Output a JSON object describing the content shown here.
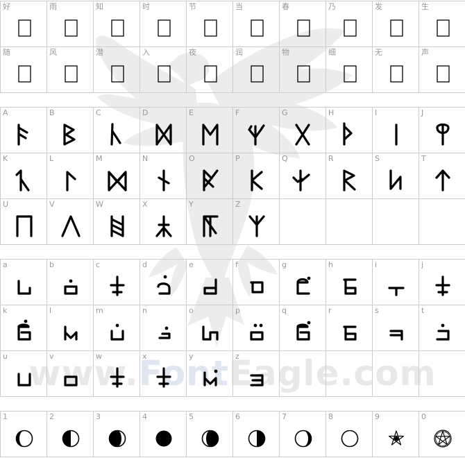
{
  "watermark": {
    "brand_prefix": "www.",
    "brand_font": "Font",
    "brand_eagle": "Eagle",
    "brand_suffix": ".com"
  },
  "sections": {
    "cjk": {
      "cells": [
        {
          "label": "好",
          "glyph": "tofu"
        },
        {
          "label": "雨",
          "glyph": "tofu"
        },
        {
          "label": "知",
          "glyph": "tofu"
        },
        {
          "label": "时",
          "glyph": "tofu"
        },
        {
          "label": "节",
          "glyph": "tofu"
        },
        {
          "label": "当",
          "glyph": "tofu"
        },
        {
          "label": "春",
          "glyph": "tofu"
        },
        {
          "label": "乃",
          "glyph": "tofu"
        },
        {
          "label": "发",
          "glyph": "tofu"
        },
        {
          "label": "生",
          "glyph": "tofu"
        },
        {
          "label": "随",
          "glyph": "tofu"
        },
        {
          "label": "风",
          "glyph": "tofu"
        },
        {
          "label": "潜",
          "glyph": "tofu"
        },
        {
          "label": "入",
          "glyph": "tofu"
        },
        {
          "label": "夜",
          "glyph": "tofu"
        },
        {
          "label": "润",
          "glyph": "tofu"
        },
        {
          "label": "物",
          "glyph": "tofu"
        },
        {
          "label": "细",
          "glyph": "tofu"
        },
        {
          "label": "无",
          "glyph": "tofu"
        },
        {
          "label": "声",
          "glyph": "tofu"
        }
      ]
    },
    "uppercase": {
      "cells": [
        {
          "label": "A",
          "glyph": "rune-f"
        },
        {
          "label": "B",
          "glyph": "rune-b"
        },
        {
          "label": "C",
          "glyph": "rune-c"
        },
        {
          "label": "D",
          "glyph": "rune-d"
        },
        {
          "label": "E",
          "glyph": "rune-e"
        },
        {
          "label": "F",
          "glyph": "rune-fw"
        },
        {
          "label": "G",
          "glyph": "rune-g"
        },
        {
          "label": "H",
          "glyph": "rune-h"
        },
        {
          "label": "I",
          "glyph": "rune-i"
        },
        {
          "label": "J",
          "glyph": "rune-j"
        },
        {
          "label": "K",
          "glyph": "rune-k"
        },
        {
          "label": "L",
          "glyph": "rune-l"
        },
        {
          "label": "M",
          "glyph": "rune-m"
        },
        {
          "label": "N",
          "glyph": "rune-n"
        },
        {
          "label": "O",
          "glyph": "rune-o"
        },
        {
          "label": "P",
          "glyph": "rune-p"
        },
        {
          "label": "Q",
          "glyph": "rune-q"
        },
        {
          "label": "R",
          "glyph": "rune-r"
        },
        {
          "label": "S",
          "glyph": "rune-s"
        },
        {
          "label": "T",
          "glyph": "rune-t"
        },
        {
          "label": "U",
          "glyph": "rune-u"
        },
        {
          "label": "V",
          "glyph": "rune-v"
        },
        {
          "label": "W",
          "glyph": "rune-w"
        },
        {
          "label": "X",
          "glyph": "rune-x"
        },
        {
          "label": "Y",
          "glyph": "rune-y"
        },
        {
          "label": "Z",
          "glyph": "rune-z"
        },
        {
          "label": "",
          "glyph": ""
        },
        {
          "label": "",
          "glyph": ""
        },
        {
          "label": "",
          "glyph": ""
        },
        {
          "label": "",
          "glyph": ""
        }
      ]
    },
    "lowercase": {
      "cells": [
        {
          "label": "a",
          "glyph": "tng-a"
        },
        {
          "label": "b",
          "glyph": "tng-b"
        },
        {
          "label": "c",
          "glyph": "tng-c"
        },
        {
          "label": "d",
          "glyph": "tng-d"
        },
        {
          "label": "e",
          "glyph": "tng-e"
        },
        {
          "label": "f",
          "glyph": "tng-f"
        },
        {
          "label": "g",
          "glyph": "tng-g"
        },
        {
          "label": "h",
          "glyph": "tng-h"
        },
        {
          "label": "i",
          "glyph": "tng-i"
        },
        {
          "label": "j",
          "glyph": "tng-j"
        },
        {
          "label": "k",
          "glyph": "tng-k"
        },
        {
          "label": "l",
          "glyph": "tng-l"
        },
        {
          "label": "m",
          "glyph": "tng-m"
        },
        {
          "label": "n",
          "glyph": "tng-n"
        },
        {
          "label": "o",
          "glyph": "tng-o"
        },
        {
          "label": "p",
          "glyph": "tng-p"
        },
        {
          "label": "q",
          "glyph": "tng-q"
        },
        {
          "label": "r",
          "glyph": "tng-r"
        },
        {
          "label": "s",
          "glyph": "tng-s"
        },
        {
          "label": "t",
          "glyph": "tng-t"
        },
        {
          "label": "u",
          "glyph": "tng-u"
        },
        {
          "label": "v",
          "glyph": "tng-v"
        },
        {
          "label": "w",
          "glyph": "tng-w"
        },
        {
          "label": "x",
          "glyph": "tng-x"
        },
        {
          "label": "y",
          "glyph": "tng-y"
        },
        {
          "label": "z",
          "glyph": "tng-z"
        },
        {
          "label": "",
          "glyph": ""
        },
        {
          "label": "",
          "glyph": ""
        },
        {
          "label": "",
          "glyph": ""
        },
        {
          "label": "",
          "glyph": ""
        }
      ]
    },
    "numbers": {
      "cells": [
        {
          "label": "1",
          "glyph": "moon-waxing-crescent"
        },
        {
          "label": "2",
          "glyph": "moon-first-quarter"
        },
        {
          "label": "3",
          "glyph": "moon-waxing-gibbous"
        },
        {
          "label": "4",
          "glyph": "moon-new"
        },
        {
          "label": "5",
          "glyph": "moon-waning-gibbous"
        },
        {
          "label": "6",
          "glyph": "moon-last-quarter"
        },
        {
          "label": "7",
          "glyph": "moon-waning-crescent"
        },
        {
          "label": "8",
          "glyph": "moon-full"
        },
        {
          "label": "9",
          "glyph": "pentagram"
        },
        {
          "label": "0",
          "glyph": "pentacle"
        }
      ]
    }
  }
}
